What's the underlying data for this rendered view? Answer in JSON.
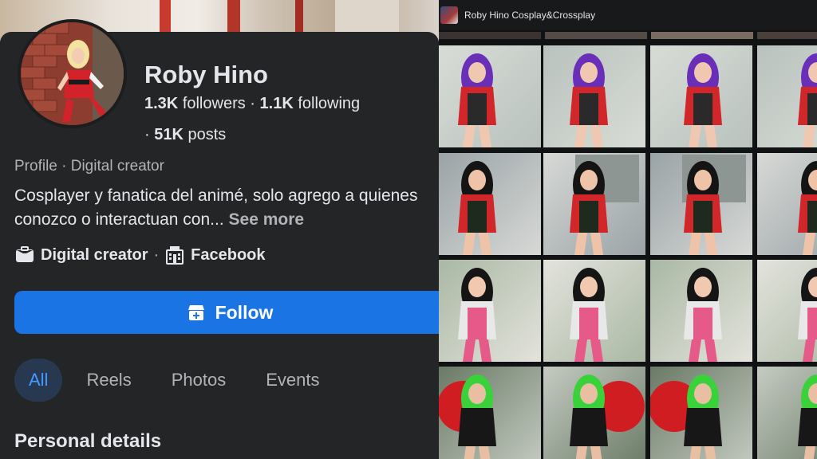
{
  "profile": {
    "name": "Roby Hino",
    "followers_count": "1.3K",
    "followers_label": "followers",
    "following_count": "1.1K",
    "following_label": "following",
    "posts_count": "51K",
    "posts_label": "posts",
    "category": "Profile · Digital creator",
    "bio": "Cosplayer y fanatica del animé, solo agrego a quienes conozco o interactuan con...",
    "see_more": "See more",
    "chips": [
      {
        "icon": "briefcase-icon",
        "label": "Digital creator"
      },
      {
        "icon": "facebook-page-icon",
        "label": "Facebook"
      }
    ]
  },
  "follow_button": {
    "label": "Follow",
    "icon": "add-friend-icon"
  },
  "tabs": [
    "All",
    "Reels",
    "Photos",
    "Events"
  ],
  "active_tab": "All",
  "section_title": "Personal details",
  "album": {
    "title": "Roby Hino Cosplay&Crossplay",
    "rows": [
      {
        "theme": "purple-hair-red-jacket"
      },
      {
        "theme": "black-hair-red-jacket-deck-8a"
      },
      {
        "theme": "pink-overalls"
      },
      {
        "theme": "green-hair-red-fan"
      }
    ]
  },
  "colors": {
    "accent": "#1b74e4",
    "panel": "#242526",
    "text": "#e4e6eb",
    "muted": "#b0b3b8",
    "tab_active_bg": "#263951",
    "tab_active_text": "#4599ff"
  }
}
